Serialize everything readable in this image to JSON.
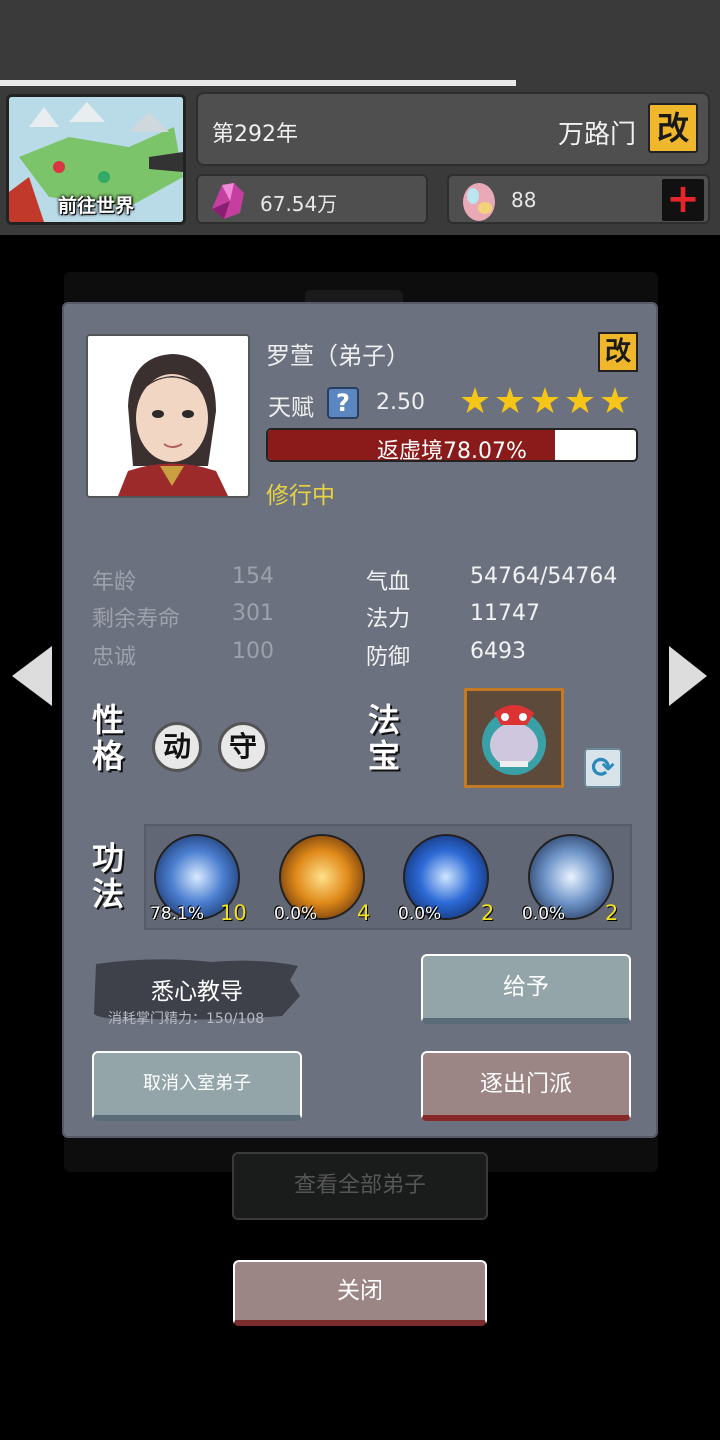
{
  "header": {
    "world_button_label": "前往世界",
    "year": "第292年",
    "sect_name": "万路门",
    "rename_glyph": "改",
    "spirit_stones": "67.54万",
    "spirit_eggs": "88",
    "add_glyph": "+"
  },
  "disciple": {
    "name": "罗萱（弟子）",
    "rename_glyph": "改",
    "talent_label": "天赋",
    "help_glyph": "?",
    "talent_value": "2.50",
    "star_count": 5,
    "realm_progress_text": "返虚境78.07%",
    "realm_progress": 0.7807,
    "status": "修行中"
  },
  "stats": {
    "left": [
      {
        "key": "年龄",
        "value": "154"
      },
      {
        "key": "剩余寿命",
        "value": "301"
      },
      {
        "key": "忠诚",
        "value": "100"
      }
    ],
    "right": [
      {
        "key": "气血",
        "value": "54764/54764"
      },
      {
        "key": "法力",
        "value": "11747"
      },
      {
        "key": "防御",
        "value": "6493"
      }
    ]
  },
  "personality": {
    "label_1": "性",
    "label_2": "格",
    "traits": [
      "动",
      "守"
    ]
  },
  "treasure": {
    "label_1": "法",
    "label_2": "宝"
  },
  "skills": {
    "label_1": "功",
    "label_2": "法",
    "items": [
      {
        "progress": "78.1%",
        "level": "10",
        "icon": "yin-yang-skill-icon"
      },
      {
        "progress": "0.0%",
        "level": "4",
        "icon": "golden-fist-skill-icon"
      },
      {
        "progress": "0.0%",
        "level": "2",
        "icon": "whirlwind-skill-icon"
      },
      {
        "progress": "0.0%",
        "level": "2",
        "icon": "sword-array-skill-icon"
      }
    ]
  },
  "actions": {
    "teach_label": "悉心教导",
    "teach_cost": "消耗掌门精力：150/108",
    "give_label": "给予",
    "cancel_inner_label": "取消入室弟子",
    "expel_label": "逐出门派",
    "view_all_label": "查看全部弟子",
    "close_label": "关闭"
  },
  "colors": {
    "gold": "#efb82c",
    "progress_red": "#8b1a1a",
    "status_yellow": "#e7d240",
    "level_yellow": "#f3e11a"
  }
}
